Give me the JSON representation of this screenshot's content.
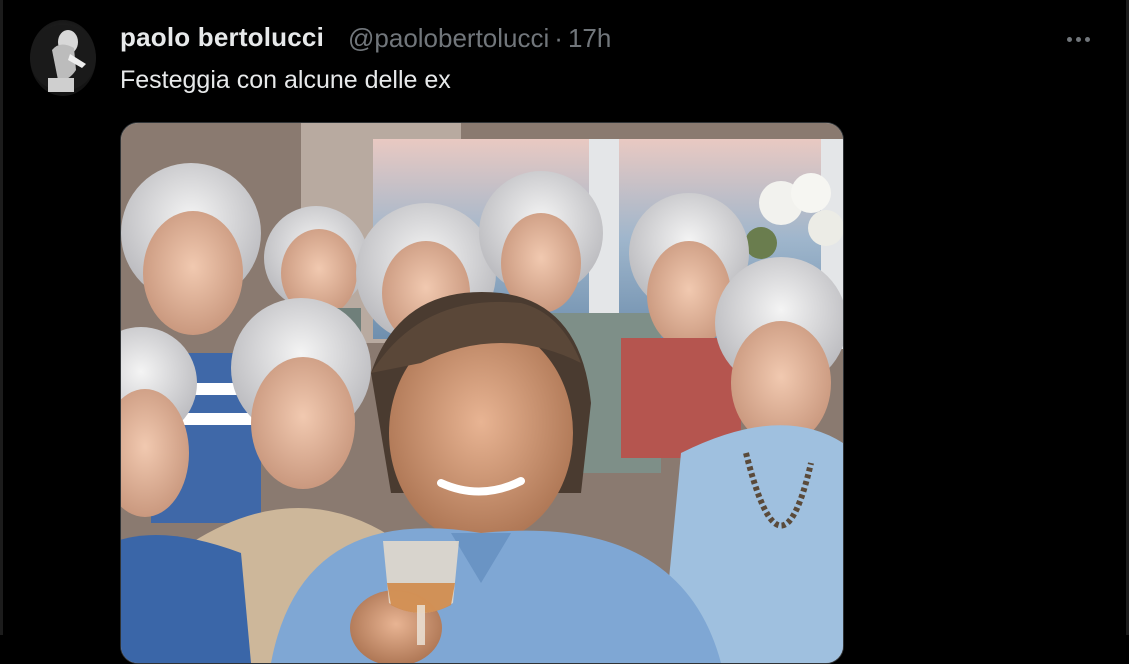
{
  "tweet": {
    "display_name": "paolo bertolucci",
    "handle": "@paolobertolucci",
    "separator": "·",
    "time": "17h",
    "text": "Festeggia con alcune delle ex",
    "more_icon": "more-horizontal-icon",
    "avatar_icon": "avatar-image"
  },
  "media": {
    "kind": "photo",
    "description_icon": "photo-image"
  },
  "colors": {
    "background": "#000000",
    "primary_text": "#e7e9ea",
    "secondary_text": "#71767b",
    "border": "#2f3336"
  }
}
